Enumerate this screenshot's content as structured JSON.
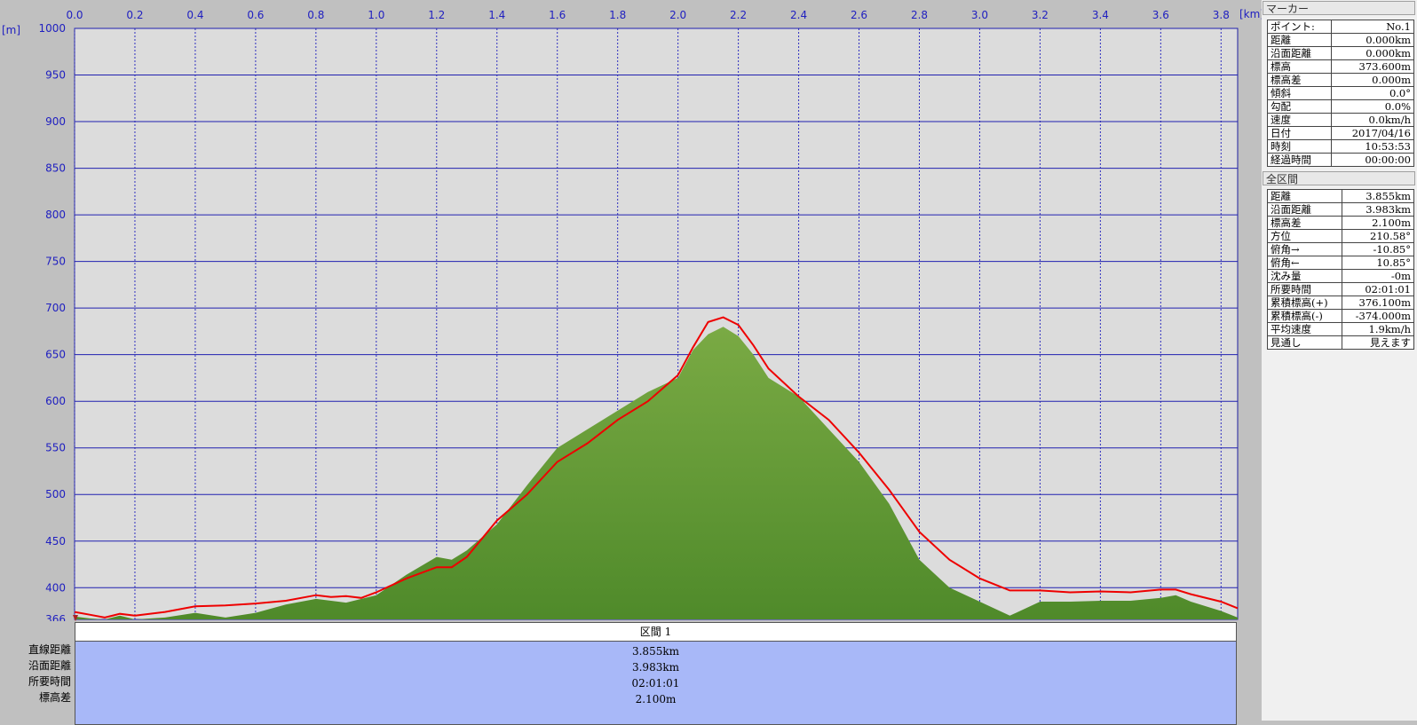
{
  "chart_data": {
    "type": "area",
    "xlabel": "[km]",
    "ylabel": "[m]",
    "xlim": [
      0,
      3.855
    ],
    "ylim": [
      366,
      1000
    ],
    "x_ticks": [
      "0.0",
      "0.2",
      "0.4",
      "0.6",
      "0.8",
      "1.0",
      "1.2",
      "1.4",
      "1.6",
      "1.8",
      "2.0",
      "2.2",
      "2.4",
      "2.6",
      "2.8",
      "3.0",
      "3.2",
      "3.4",
      "3.6",
      "3.8"
    ],
    "y_ticks": [
      "1000",
      "950",
      "900",
      "850",
      "800",
      "750",
      "700",
      "650",
      "600",
      "550",
      "500",
      "450",
      "400",
      "366"
    ],
    "grid": true,
    "series": [
      {
        "kind": "terrain",
        "color": "#5f9a32",
        "x": [
          0,
          0.05,
          0.1,
          0.15,
          0.2,
          0.3,
          0.4,
          0.5,
          0.6,
          0.7,
          0.8,
          0.9,
          1.0,
          1.1,
          1.2,
          1.25,
          1.3,
          1.4,
          1.5,
          1.6,
          1.7,
          1.8,
          1.9,
          2.0,
          2.05,
          2.1,
          2.15,
          2.2,
          2.25,
          2.3,
          2.4,
          2.5,
          2.6,
          2.7,
          2.8,
          2.9,
          3.0,
          3.1,
          3.2,
          3.3,
          3.4,
          3.5,
          3.6,
          3.65,
          3.7,
          3.8,
          3.855
        ],
        "values": [
          369,
          367,
          366,
          370,
          366,
          368,
          373,
          368,
          373,
          382,
          388,
          384,
          392,
          414,
          433,
          430,
          440,
          468,
          510,
          550,
          570,
          590,
          610,
          625,
          655,
          672,
          680,
          670,
          650,
          625,
          605,
          570,
          535,
          490,
          430,
          400,
          385,
          370,
          385,
          385,
          386,
          386,
          389,
          392,
          385,
          375,
          368
        ]
      },
      {
        "kind": "track",
        "color": "#ee0000",
        "x": [
          0,
          0.05,
          0.1,
          0.15,
          0.2,
          0.3,
          0.4,
          0.5,
          0.6,
          0.7,
          0.8,
          0.85,
          0.9,
          0.95,
          1.0,
          1.1,
          1.2,
          1.25,
          1.3,
          1.4,
          1.5,
          1.6,
          1.7,
          1.8,
          1.9,
          2.0,
          2.05,
          2.1,
          2.15,
          2.2,
          2.25,
          2.3,
          2.4,
          2.5,
          2.6,
          2.7,
          2.8,
          2.9,
          3.0,
          3.1,
          3.2,
          3.3,
          3.4,
          3.5,
          3.6,
          3.65,
          3.7,
          3.8,
          3.855
        ],
        "values": [
          374,
          371,
          368,
          372,
          370,
          374,
          380,
          381,
          383,
          386,
          392,
          390,
          391,
          389,
          395,
          410,
          422,
          422,
          433,
          472,
          500,
          535,
          555,
          580,
          600,
          628,
          658,
          685,
          690,
          682,
          660,
          635,
          605,
          580,
          545,
          505,
          460,
          430,
          410,
          397,
          397,
          395,
          396,
          395,
          398,
          398,
          393,
          385,
          378
        ]
      }
    ]
  },
  "marker_header": "マーカー",
  "marker_rows": [
    {
      "label": "ポイント:",
      "value": "No.1"
    },
    {
      "label": "距離",
      "value": "0.000km"
    },
    {
      "label": "沿面距離",
      "value": "0.000km"
    },
    {
      "label": "標高",
      "value": "373.600m"
    },
    {
      "label": "標高差",
      "value": "0.000m"
    },
    {
      "label": "傾斜",
      "value": "0.0°"
    },
    {
      "label": "勾配",
      "value": "0.0%"
    },
    {
      "label": "速度",
      "value": "0.0km/h"
    },
    {
      "label": "日付",
      "value": "2017/04/16"
    },
    {
      "label": "時刻",
      "value": "10:53:53"
    },
    {
      "label": "経過時間",
      "value": "00:00:00"
    }
  ],
  "range_header": "全区間",
  "range_rows": [
    {
      "label": "距離",
      "value": "3.855km"
    },
    {
      "label": "沿面距離",
      "value": "3.983km"
    },
    {
      "label": "標高差",
      "value": "2.100m"
    },
    {
      "label": "方位",
      "value": "210.58°"
    },
    {
      "label": "俯角→",
      "value": "-10.85°"
    },
    {
      "label": "俯角←",
      "value": "10.85°"
    },
    {
      "label": "沈み量",
      "value": "-0m"
    },
    {
      "label": "所要時間",
      "value": "02:01:01"
    },
    {
      "label": "累積標高(+)",
      "value": "376.100m"
    },
    {
      "label": "累積標高(-)",
      "value": "-374.000m"
    },
    {
      "label": "平均速度",
      "value": "1.9km/h"
    },
    {
      "label": "見通し",
      "value": "見えます"
    }
  ],
  "summary": {
    "title": "区間 1",
    "labels": [
      "直線距離",
      "沿面距離",
      "所要時間",
      "標高差"
    ],
    "values": [
      "3.855km",
      "3.983km",
      "02:01:01",
      "2.100m"
    ]
  }
}
